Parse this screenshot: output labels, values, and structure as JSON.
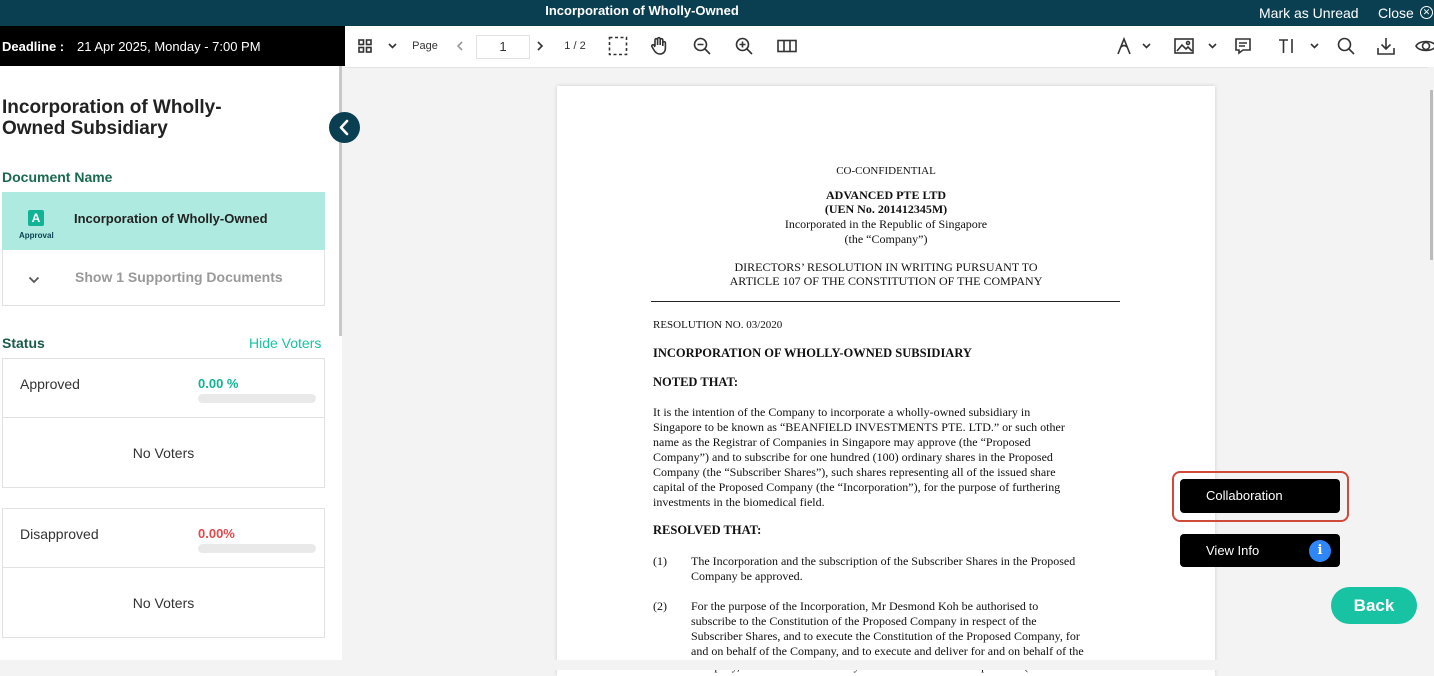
{
  "window": {
    "title": "Incorporation of Wholly-Owned",
    "mark_unread": "Mark as Unread",
    "close": "Close"
  },
  "deadline": {
    "label": "Deadline :",
    "value": "21 Apr 2025, Monday - 7:00 PM"
  },
  "toolbar": {
    "page_label": "Page",
    "page_value": "1",
    "page_total": "1 / 2",
    "icons": [
      "grid-icon",
      "chevron-down-icon",
      "chevron-left-icon",
      "chevron-right-icon",
      "marquee-select-icon",
      "hand-icon",
      "zoom-out-icon",
      "zoom-in-icon",
      "columns-icon",
      "pen-icon",
      "image-icon",
      "comment-icon",
      "text-cursor-icon",
      "search-icon",
      "download-icon",
      "eye-icon"
    ]
  },
  "left": {
    "title": "Incorporation of Wholly-Owned Subsidiary",
    "document_name_header": "Document Name",
    "document": {
      "icon_letter": "A",
      "icon_caption": "Approval",
      "name": "Incorporation of Wholly-Owned"
    },
    "supporting": "Show 1 Supporting Documents",
    "status_header": "Status",
    "hide_voters": "Hide Voters",
    "approved": {
      "label": "Approved",
      "percent": "0.00 %",
      "fraction": 0,
      "voters": "No Voters"
    },
    "disapproved": {
      "label": "Disapproved",
      "percent": "0.00%",
      "fraction": 0,
      "voters": "No Voters"
    }
  },
  "doc": {
    "confidential": "CO-CONFIDENTIAL",
    "company": "ADVANCED PTE LTD",
    "uen": "(UEN No. 201412345M)",
    "incorporated": "Incorporated in the Republic of Singapore",
    "company_def": "(the “Company”)",
    "heading1": "DIRECTORS’ RESOLUTION IN WRITING PURSUANT TO",
    "heading2": "ARTICLE 107 OF THE CONSTITUTION OF THE COMPANY",
    "resolution_no": "RESOLUTION NO. 03/2020",
    "subject": "INCORPORATION OF WHOLLY-OWNED SUBSIDIARY",
    "noted": "NOTED THAT:",
    "noted_lines": [
      "It is the intention of the Company to incorporate a wholly-owned subsidiary in",
      "Singapore to be known as “BEANFIELD INVESTMENTS PTE. LTD.” or such other",
      "name as the Registrar of Companies in Singapore may approve (the “Proposed",
      "Company”) and to subscribe for one hundred (100) ordinary shares in the Proposed",
      "Company (the “Subscriber Shares”), such shares representing all of the issued share",
      "capital of the Proposed Company (the “Incorporation”), for the purpose of furthering",
      "investments in the biomedical field."
    ],
    "resolved": "RESOLVED THAT:",
    "item1_num": "(1)",
    "item1_lines": [
      "The Incorporation and the subscription of the Subscriber Shares in the Proposed",
      "Company be approved."
    ],
    "item2_num": "(2)",
    "item2_lines": [
      "For the purpose of the Incorporation, Mr Desmond Koh be authorised to",
      "subscribe to the Constitution of the Proposed Company in respect of the",
      "Subscriber Shares, and to execute the Constitution of the Proposed Company, for",
      "and on behalf of the Company, and to execute and deliver for and on behalf of the",
      "Company, all documents necessary or incidental to the Incorporation (the"
    ]
  },
  "actions": {
    "collaboration": "Collaboration",
    "view_info": "View Info",
    "back": "Back"
  },
  "colors": {
    "header_bg": "#0a3f52",
    "accent_teal": "#17c3a3",
    "approved": "#10b495",
    "disapproved": "#e5484d",
    "highlight_ring": "#d04a3a"
  }
}
